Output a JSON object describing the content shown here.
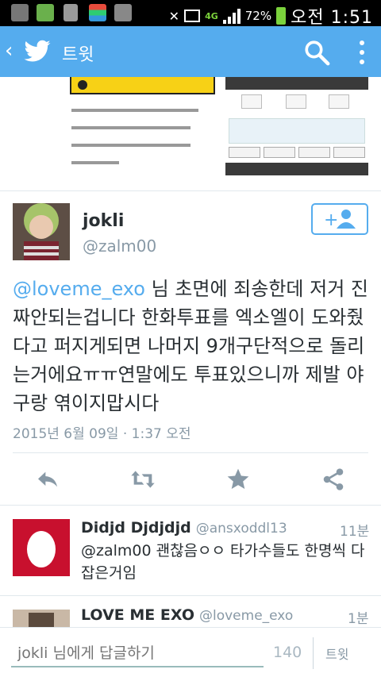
{
  "status_bar": {
    "battery_percent": "72%",
    "time": "오전 1:51",
    "network": "4G"
  },
  "app_bar": {
    "title": "트윗",
    "back_icon": "chevron-left-icon",
    "logo_icon": "twitter-bird-icon",
    "search_icon": "search-icon",
    "more_icon": "more-vertical-icon",
    "color": "#55acee"
  },
  "tweet": {
    "author_name": "jokli",
    "author_handle": "@zalm00",
    "mention": "@loveme_exo",
    "body": " 님 초면에 죄송한데 저거 진짜안되는겁니다 한화투표를 엑소엘이 도와줬다고 퍼지게되면 나머지 9개구단적으로 돌리는거에요ㅠㅠ연말에도 투표있으니까 제발 야구랑 엮이지맙시다",
    "date": "2015년 6월 09일 · 1:37 오전",
    "actions": [
      "reply-icon",
      "retweet-icon",
      "favorite-star-icon",
      "share-icon"
    ]
  },
  "replies": [
    {
      "name": "Didjd Djdjdjd",
      "handle": "@ansxoddl13",
      "time": "11분",
      "text": "@zalm00 괜찮음ㅇㅇ 타가수들도 한명씩 다 잡은거임"
    },
    {
      "name": "LOVE ME EXO",
      "handle": "@loveme_exo",
      "time": "1분",
      "text": ""
    }
  ],
  "compose": {
    "placeholder": "jokli 님에게 답글하기",
    "char_count": "140",
    "send_label": "트윗"
  }
}
